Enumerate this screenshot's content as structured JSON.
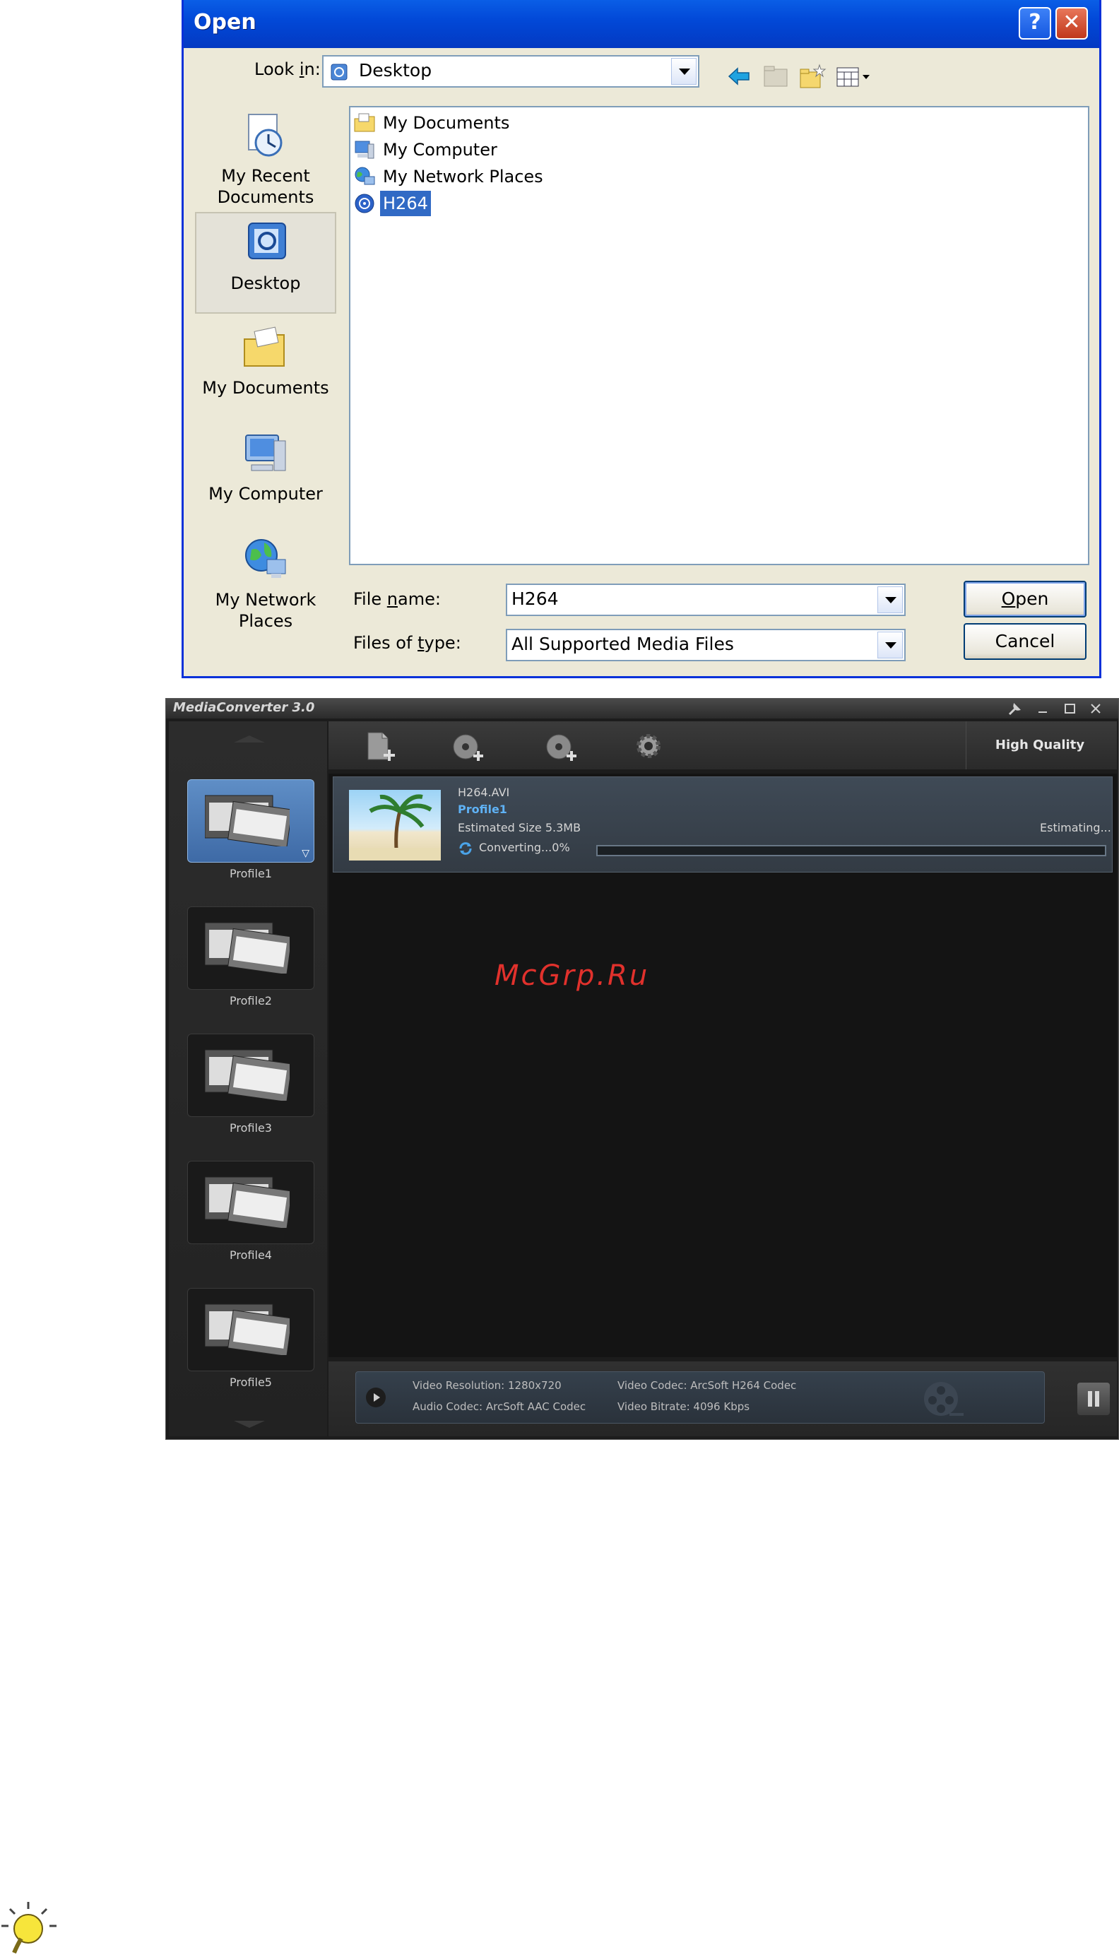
{
  "open_dialog": {
    "title": "Open",
    "help_label": "?",
    "close_label": "✕",
    "look_in": {
      "label_pre": "Look ",
      "label_ul": "i",
      "label_post": "n:",
      "value": "Desktop"
    },
    "places": [
      {
        "name": "recent",
        "label": "My Recent Documents",
        "icon": "recent-documents-icon"
      },
      {
        "name": "desktop",
        "label": "Desktop",
        "icon": "desktop-icon",
        "selected": true
      },
      {
        "name": "documents",
        "label": "My Documents",
        "icon": "folder-icon"
      },
      {
        "name": "computer",
        "label": "My Computer",
        "icon": "computer-icon"
      },
      {
        "name": "network",
        "label": "My Network Places",
        "icon": "globe-icon"
      }
    ],
    "files": [
      {
        "label": "My Documents",
        "icon": "documents-icon"
      },
      {
        "label": "My Computer",
        "icon": "computer-icon"
      },
      {
        "label": "My Network Places",
        "icon": "network-icon"
      },
      {
        "label": "H264",
        "icon": "video-file-icon",
        "selected": true
      }
    ],
    "file_name": {
      "label_pre": "File ",
      "label_ul": "n",
      "label_post": "ame:",
      "value": "H264"
    },
    "file_type": {
      "label_pre": "Files of ",
      "label_ul": "t",
      "label_post": "ype:",
      "value": "All Supported Media Files"
    },
    "open_button": {
      "ul": "O",
      "rest": "pen"
    },
    "cancel_button": "Cancel"
  },
  "media_converter": {
    "title": "MediaConverter 3.0",
    "profiles": [
      "Profile1",
      "Profile2",
      "Profile3",
      "Profile4",
      "Profile5"
    ],
    "quality_label": "High Quality",
    "job": {
      "filename": "H264.AVI",
      "profile": "Profile1",
      "estimated_size": "Estimated Size 5.3MB",
      "status": "Estimating...",
      "converting": "Converting...0%",
      "progress": 0
    },
    "info": {
      "video_resolution": "Video Resolution: 1280x720",
      "audio_codec": "Audio Codec: ArcSoft AAC Codec",
      "video_codec": "Video Codec: ArcSoft H264 Codec",
      "video_bitrate": "Video Bitrate: 4096 Kbps"
    }
  },
  "watermark": "McGrp.Ru"
}
